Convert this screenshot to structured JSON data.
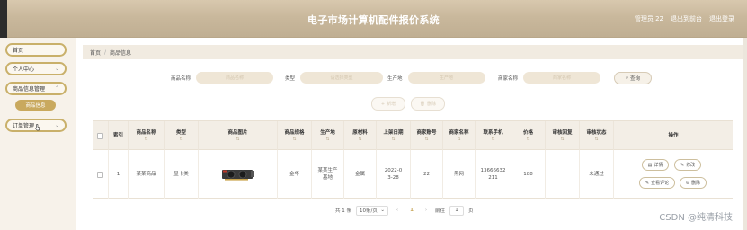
{
  "header": {
    "title": "电子市场计算机配件报价系统",
    "user_label": "管理员",
    "user_name": "22",
    "front_link": "退出到前台",
    "logout": "退出登录"
  },
  "sidebar": {
    "items": [
      {
        "label": "首页"
      },
      {
        "label": "个人中心"
      },
      {
        "label": "商品信息管理"
      },
      {
        "label": "商品信息"
      },
      {
        "label": "订单管理"
      }
    ]
  },
  "breadcrumb": {
    "home": "首页",
    "sep": "/",
    "current": "商品信息"
  },
  "search": {
    "fields": [
      {
        "label": "商品名称",
        "placeholder": "商品名称"
      },
      {
        "label": "类型",
        "placeholder": "请选择类型"
      },
      {
        "label": "生产地",
        "placeholder": "生产地"
      },
      {
        "label": "商家名称",
        "placeholder": "商家名称"
      }
    ],
    "query_label": "查询"
  },
  "actions": {
    "add": "新增",
    "delete": "删除"
  },
  "table": {
    "headers": [
      "索引",
      "商品名称",
      "类型",
      "商品图片",
      "商品规格",
      "生产地",
      "原材料",
      "上架日期",
      "商家账号",
      "商家名称",
      "联系手机",
      "价格",
      "审核回复",
      "审核状态",
      "操作"
    ],
    "rows": [
      {
        "index": "1",
        "name": "某某商品",
        "type": "显卡类",
        "spec": "金华",
        "origin": "某某生产基地",
        "material": "金属",
        "date": "2022-03-28",
        "account": "22",
        "merchant": "黑网",
        "phone": "13666632211",
        "price": "188",
        "reply": "",
        "status": "未通过"
      }
    ],
    "row_ops": {
      "detail": "详情",
      "edit": "修改",
      "comment": "查看评论",
      "remove": "删除"
    }
  },
  "pager": {
    "total": "共 1 条",
    "size": "10条/页",
    "page": "1",
    "goto": "前往",
    "goto_value": "1",
    "unit": "页"
  },
  "watermark": "CSDN @纯清科技",
  "colors": {
    "accent": "#c9a95e",
    "header": "#c9b89c",
    "panel": "#f3eee6"
  }
}
